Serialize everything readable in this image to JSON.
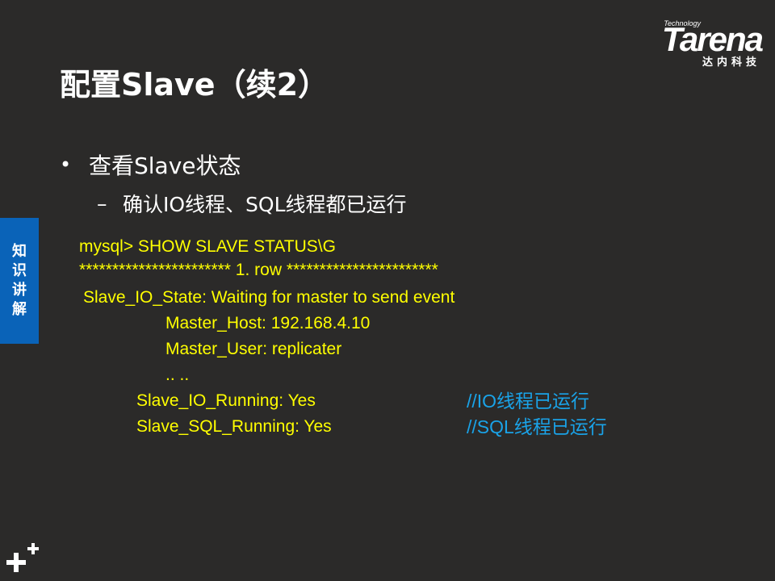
{
  "logo": {
    "tech": "Technology",
    "word": "Tarena",
    "cn": "达内科技"
  },
  "title": "配置Slave（续2）",
  "bullet": {
    "marker": "•",
    "text": "查看Slave状态"
  },
  "sub_bullet": {
    "marker": "–",
    "text": "确认IO线程、SQL线程都已运行"
  },
  "side_tab": {
    "chars": [
      "知",
      "识",
      "讲",
      "解"
    ]
  },
  "code": {
    "lines": [
      "mysql> SHOW  SLAVE  STATUS\\G",
      "*********************** 1. row ***********************",
      "Slave_IO_State: Waiting for master to send event",
      "Master_Host: 192.168.4.10",
      "Master_User: replicater",
      ".. ..",
      "Slave_IO_Running: Yes",
      "Slave_SQL_Running: Yes"
    ],
    "comments": [
      "//IO线程已运行",
      "//SQL线程已运行"
    ]
  },
  "colors": {
    "background": "#2b2a29",
    "code": "#ffff00",
    "comment": "#1aa3e8",
    "side_tab": "#0a63b8"
  },
  "icons": {
    "bottom_left": "plus-icon"
  }
}
